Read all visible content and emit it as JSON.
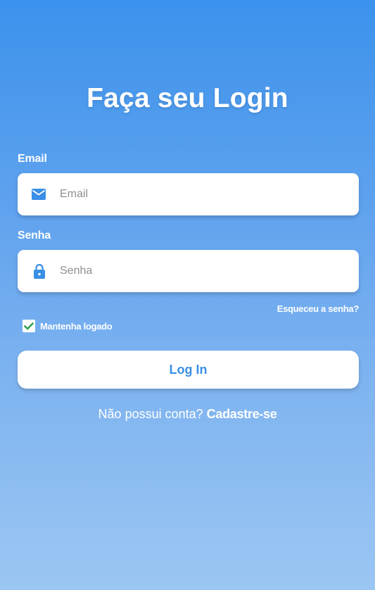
{
  "login": {
    "title": "Faça seu Login",
    "email": {
      "label": "Email",
      "placeholder": "Email",
      "icon": "mail-icon"
    },
    "password": {
      "label": "Senha",
      "placeholder": "Senha",
      "icon": "lock-icon"
    },
    "forgot_password": "Esqueceu a senha?",
    "remember_me": {
      "label": "Mantenha logado",
      "checked": true
    },
    "login_button": "Log In",
    "signup_prompt": "Não possui conta?",
    "signup_link": "Cadastre-se"
  },
  "colors": {
    "gradient_top": "#3b92ec",
    "gradient_bottom": "#9bc6f3",
    "accent": "#3a8fe6",
    "check": "#2a9d4a"
  }
}
